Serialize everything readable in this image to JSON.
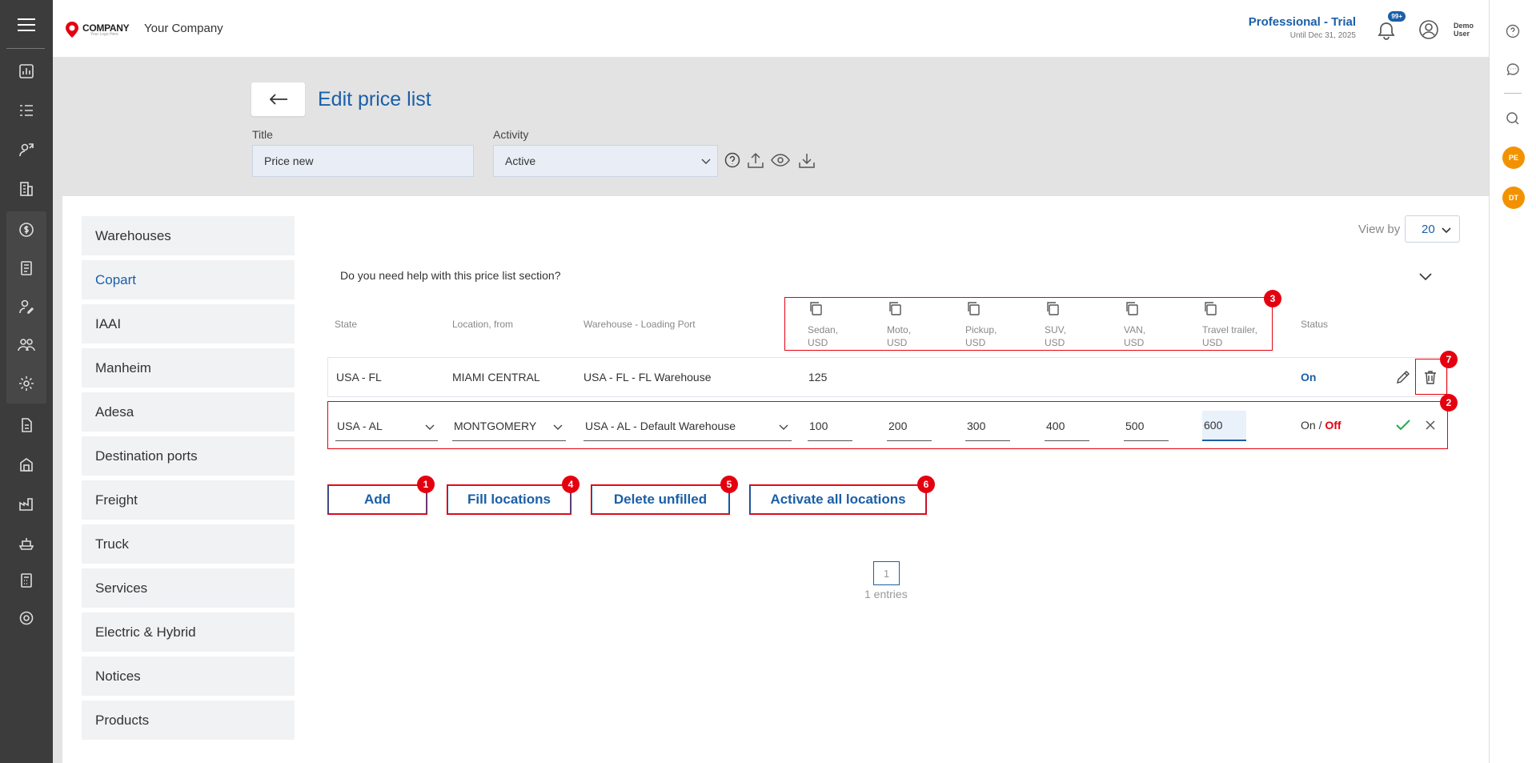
{
  "header": {
    "logo_text": "COMPANY",
    "logo_sub": "Your Logo Here",
    "company_name": "Your Company",
    "plan_title": "Professional - Trial",
    "plan_until": "Until Dec 31, 2025",
    "notif_badge": "99+",
    "user_line1": "Demo",
    "user_line2": "User"
  },
  "page": {
    "title": "Edit price list",
    "title_label": "Title",
    "title_value": "Price new",
    "activity_label": "Activity",
    "activity_value": "Active"
  },
  "sidebar": {
    "items": [
      {
        "label": "Warehouses"
      },
      {
        "label": "Copart"
      },
      {
        "label": "IAAI"
      },
      {
        "label": "Manheim"
      },
      {
        "label": "Adesa"
      },
      {
        "label": "Destination ports"
      },
      {
        "label": "Freight"
      },
      {
        "label": "Truck"
      },
      {
        "label": "Services"
      },
      {
        "label": "Electric & Hybrid"
      },
      {
        "label": "Notices"
      },
      {
        "label": "Products"
      }
    ],
    "active_index": 1
  },
  "view_by": {
    "label": "View by",
    "value": "20"
  },
  "help_text": "Do you need help with this price list section?",
  "table": {
    "headers": {
      "state": "State",
      "location": "Location, from",
      "warehouse": "Warehouse - Loading Port",
      "status": "Status"
    },
    "price_columns": [
      {
        "l1": "Sedan,",
        "l2": "USD"
      },
      {
        "l1": "Moto,",
        "l2": "USD"
      },
      {
        "l1": "Pickup,",
        "l2": "USD"
      },
      {
        "l1": "SUV,",
        "l2": "USD"
      },
      {
        "l1": "VAN,",
        "l2": "USD"
      },
      {
        "l1": "Travel trailer,",
        "l2": "USD"
      }
    ],
    "row1": {
      "state": "USA - FL",
      "location": "MIAMI CENTRAL",
      "warehouse": "USA - FL - FL Warehouse",
      "sedan": "125",
      "status": "On"
    },
    "edit_row": {
      "state": "USA - AL",
      "location": "MONTGOMERY",
      "warehouse": "USA - AL - Default Warehouse",
      "prices": [
        "100",
        "200",
        "300",
        "400",
        "500",
        "600"
      ],
      "status_on": "On",
      "status_sep": " / ",
      "status_off": "Off"
    }
  },
  "buttons": {
    "add": "Add",
    "fill": "Fill locations",
    "delete_unfilled": "Delete unfilled",
    "activate_all": "Activate all locations"
  },
  "markers": [
    "1",
    "2",
    "3",
    "4",
    "5",
    "6",
    "7"
  ],
  "pagination": {
    "page": "1",
    "entries": "1 entries"
  },
  "avatars": [
    "PE",
    "DT"
  ],
  "colors": {
    "accent": "#1a5fa8",
    "marker_red": "#e4000f",
    "avatar_orange": "#f39200"
  }
}
